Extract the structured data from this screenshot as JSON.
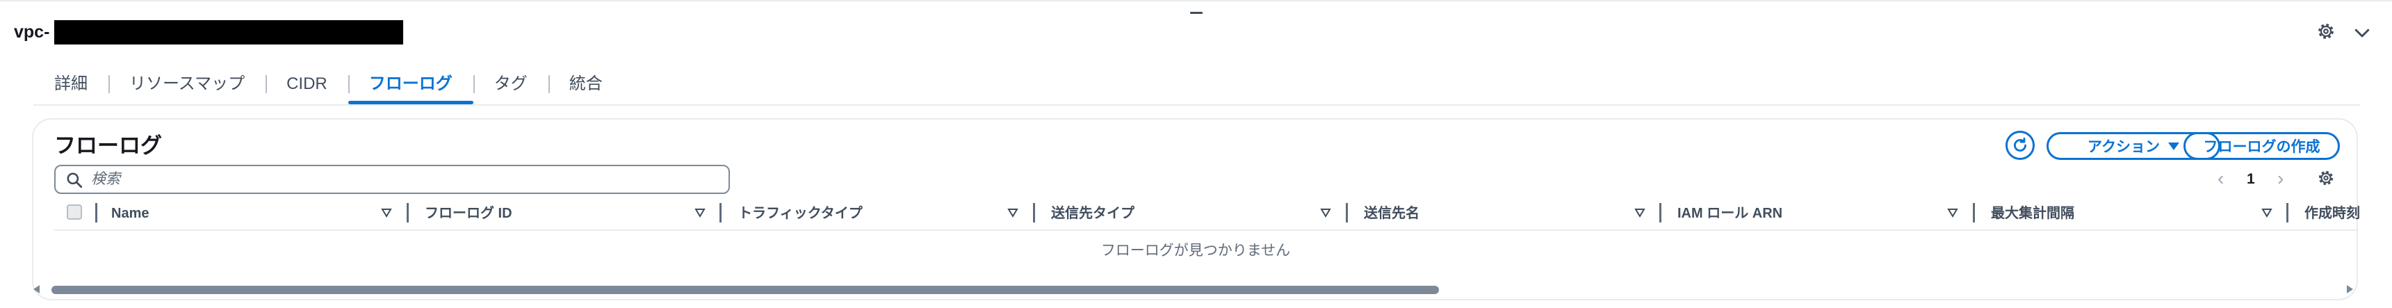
{
  "header": {
    "title": "vpc-"
  },
  "tabs": [
    {
      "label": "詳細"
    },
    {
      "label": "リソースマップ"
    },
    {
      "label": "CIDR"
    },
    {
      "label": "フローログ",
      "active": true
    },
    {
      "label": "タグ"
    },
    {
      "label": "統合"
    }
  ],
  "panel": {
    "title": "フローログ",
    "actions_label": "アクション",
    "create_label": "フローログの作成",
    "search_placeholder": "検索",
    "page": "1",
    "columns": [
      "Name",
      "フローログ ID",
      "トラフィックタイプ",
      "送信先タイプ",
      "送信先名",
      "IAM ロール ARN",
      "最大集計間隔",
      "作成時刻"
    ],
    "empty_message": "フローログが見つかりません"
  },
  "colors": {
    "accent": "#0972d3",
    "text": "#16191f",
    "muted": "#5f6b7a"
  }
}
